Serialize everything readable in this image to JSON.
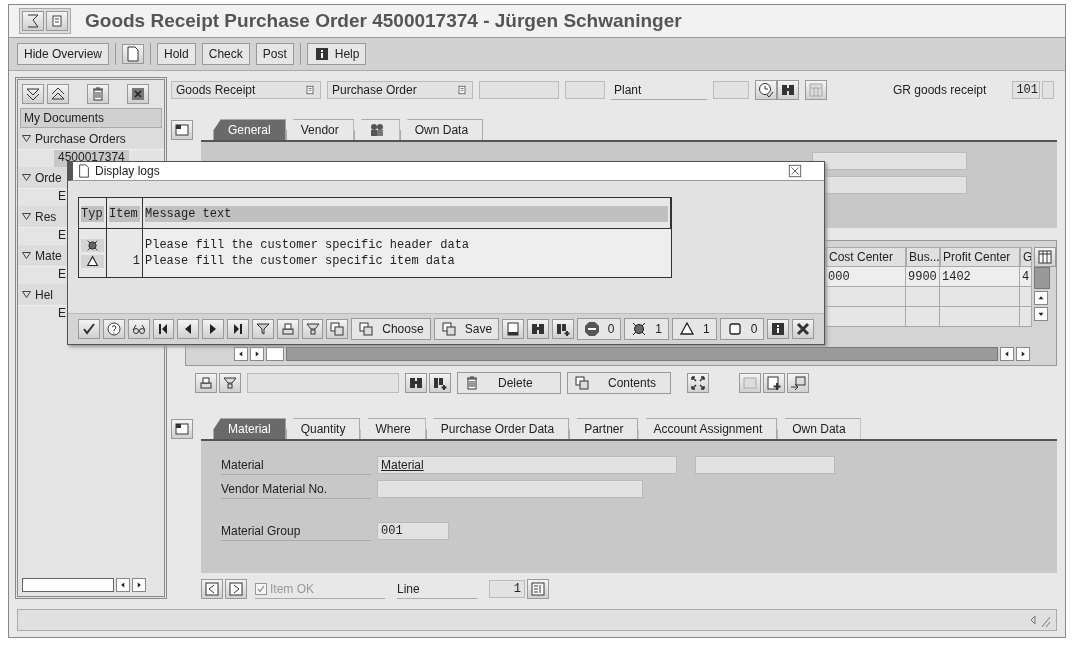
{
  "window": {
    "title": "Goods Receipt Purchase Order 4500017374 - Jürgen Schwaninger"
  },
  "toolbar": {
    "buttons": [
      {
        "label": "Hide Overview"
      },
      {
        "label": "Hold"
      },
      {
        "label": "Check"
      },
      {
        "label": "Post"
      },
      {
        "label": "Help"
      }
    ]
  },
  "nav": {
    "header": "My Documents",
    "items": [
      {
        "label": "Purchase Orders",
        "expanded": true,
        "children": [
          {
            "label": "4500017374",
            "selected": true
          }
        ]
      },
      {
        "label": "Orde",
        "expanded": true,
        "children": [
          {
            "label": "E",
            "selected": false
          }
        ]
      },
      {
        "label": "Res",
        "expanded": true,
        "children": [
          {
            "label": "E",
            "selected": false
          }
        ]
      },
      {
        "label": "Mate",
        "expanded": true,
        "children": [
          {
            "label": "E",
            "selected": false
          }
        ]
      },
      {
        "label": "Hel",
        "expanded": true,
        "children": [
          {
            "label": "E",
            "selected": false
          }
        ]
      }
    ]
  },
  "header": {
    "transaction": "Goods Receipt",
    "reference": "Purchase Order",
    "plant_label": "Plant",
    "movement_label": "GR goods receipt",
    "movement_type": "101"
  },
  "header_tabs": [
    {
      "kind": "text",
      "label": "General",
      "selected": true
    },
    {
      "kind": "text",
      "label": "Vendor",
      "selected": false
    },
    {
      "kind": "icon",
      "selected": false
    },
    {
      "kind": "text",
      "label": "Own Data",
      "selected": false
    }
  ],
  "items_table": {
    "columns": [
      "Cost Center",
      "Bus...",
      "Profit Center",
      "G"
    ],
    "rows": [
      [
        "000",
        "9900",
        "1402",
        "4"
      ]
    ]
  },
  "table_toolbar": {
    "buttons": [
      {
        "label": "Delete"
      },
      {
        "label": "Contents"
      }
    ]
  },
  "detail_tabs": [
    {
      "label": "Material",
      "selected": true
    },
    {
      "label": "Quantity",
      "selected": false
    },
    {
      "label": "Where",
      "selected": false
    },
    {
      "label": "Purchase Order Data",
      "selected": false
    },
    {
      "label": "Partner",
      "selected": false
    },
    {
      "label": "Account Assignment",
      "selected": false
    },
    {
      "label": "Own Data",
      "selected": false
    }
  ],
  "detail_fields": [
    {
      "label": "Material",
      "value": "Material"
    },
    {
      "label": "Vendor Material No."
    },
    {
      "label": "Material Group",
      "value": "001"
    }
  ],
  "footer": {
    "item_ok": {
      "label": "Item OK",
      "checked": true,
      "disabled": true
    },
    "line_label": "Line",
    "line_value": "1"
  },
  "dialog": {
    "title": "Display logs",
    "columns": [
      "Typ",
      "Item",
      "Message text"
    ],
    "rows": [
      {
        "kind": "error",
        "text": "Please fill the customer specific header data"
      },
      {
        "kind": "warning",
        "item": "1",
        "text": "Please fill the customer specific item data"
      }
    ],
    "buttons": [
      {
        "label": "Choose"
      },
      {
        "label": "Save"
      }
    ],
    "counts": [
      {
        "kind": "stop",
        "count": "0"
      },
      {
        "kind": "error",
        "count": "1"
      },
      {
        "kind": "warning",
        "count": "1"
      },
      {
        "kind": "info",
        "count": "0"
      }
    ]
  }
}
